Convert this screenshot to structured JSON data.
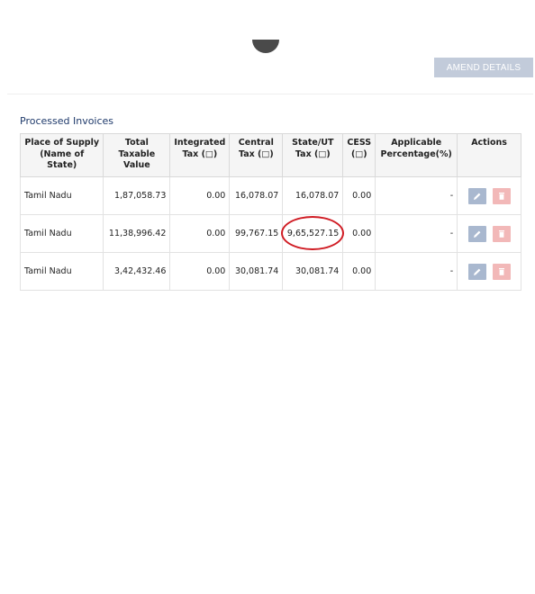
{
  "header": {
    "amend_button_label": "AMEND DETAILS"
  },
  "section": {
    "title": "Processed Invoices"
  },
  "table": {
    "columns": [
      "Place of Supply (Name of State)",
      "Total Taxable Value",
      "Integrated Tax (□)",
      "Central Tax (□)",
      "State/UT Tax (□)",
      "CESS (□)",
      "Applicable Percentage(%)",
      "Actions"
    ],
    "rows": [
      {
        "place": "Tamil Nadu",
        "taxable": "1,87,058.73",
        "integrated": "0.00",
        "central": "16,078.07",
        "state": "16,078.07",
        "cess": "0.00",
        "percentage": "-"
      },
      {
        "place": "Tamil Nadu",
        "taxable": "11,38,996.42",
        "integrated": "0.00",
        "central": "99,767.15",
        "state": "9,65,527.15",
        "cess": "0.00",
        "percentage": "-"
      },
      {
        "place": "Tamil Nadu",
        "taxable": "3,42,432.46",
        "integrated": "0.00",
        "central": "30,081.74",
        "state": "30,081.74",
        "cess": "0.00",
        "percentage": "-"
      }
    ]
  },
  "icons": {
    "edit": "pencil-icon",
    "delete": "trash-icon"
  },
  "colors": {
    "amend_button": "#c2cbda",
    "edit_button": "#a9b8cf",
    "delete_button": "#f2b8b8",
    "highlight": "#d01c24",
    "section_title": "#1f3a6b"
  }
}
